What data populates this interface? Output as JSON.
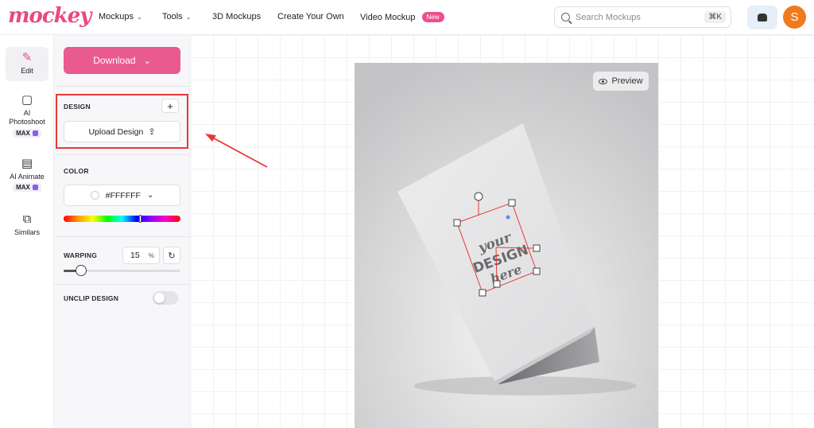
{
  "brand": {
    "logo_text": "mockey",
    "color": "#e84a7f"
  },
  "nav": {
    "mockups": "Mockups",
    "tools": "Tools",
    "three_d": "3D Mockups",
    "create": "Create Your Own",
    "video": "Video Mockup",
    "new_badge": "New"
  },
  "search": {
    "placeholder": "Search Mockups",
    "shortcut": "⌘K"
  },
  "user": {
    "initial": "S"
  },
  "rail": {
    "edit": "Edit",
    "ai_photoshoot": "AI Photoshoot",
    "ai_animate": "AI Animate",
    "similars": "Similars",
    "max_badge": "MAX"
  },
  "panel": {
    "download_label": "Download",
    "design_label": "DESIGN",
    "upload_label": "Upload Design",
    "color_label": "COLOR",
    "color_value": "#FFFFFF",
    "hue_position": 0.65,
    "warping_label": "WARPING",
    "warping_value": "15",
    "warping_unit": "%",
    "warping_fraction": 0.15,
    "unclip_label": "UNCLIP DESIGN",
    "unclip_on": false
  },
  "canvas": {
    "preview_label": "Preview",
    "design_text": {
      "line1": "your",
      "line2": "DESIGN",
      "line3": "here"
    }
  },
  "colors": {
    "accent": "#e95a8f",
    "highlight_border": "#e53935",
    "avatar": "#f07a1d"
  }
}
